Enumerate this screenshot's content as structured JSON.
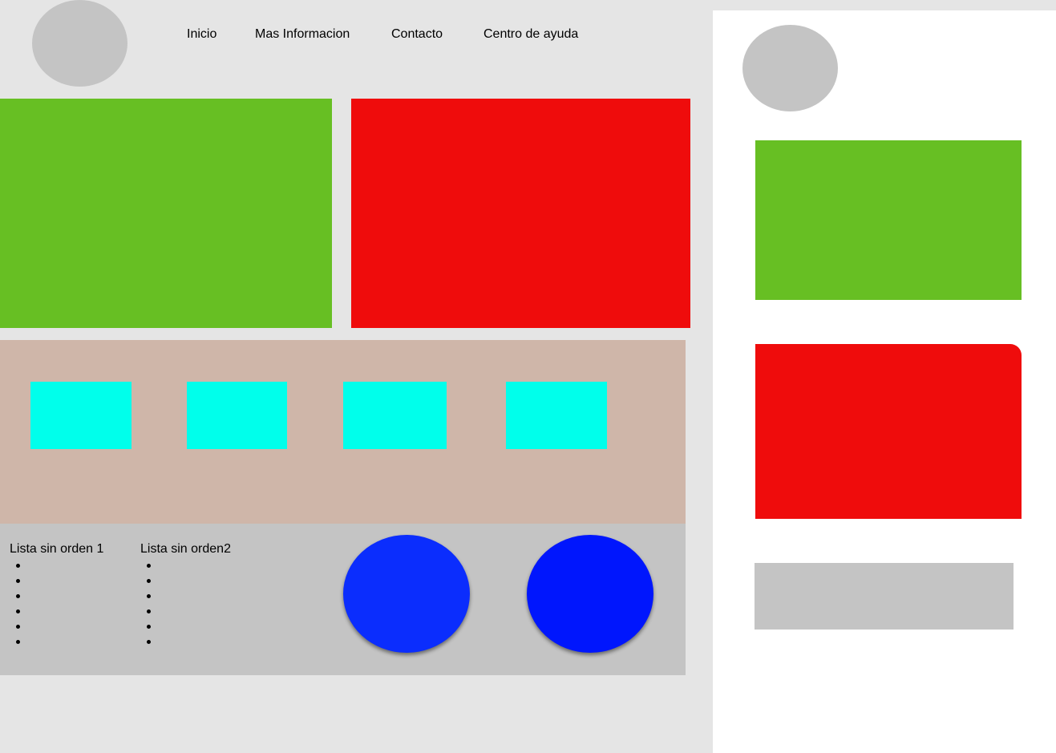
{
  "colors": {
    "background": "#e5e5e5",
    "mobile_background": "#ffffff",
    "placeholder_gray": "#c4c4c4",
    "green": "#67bf23",
    "red": "#ef0c0c",
    "tan": "#cfb6a9",
    "cyan": "#00ffeb",
    "blue_1": "#0b2dfd",
    "blue_2": "#0016fd"
  },
  "nav": {
    "items": [
      {
        "label": "Inicio"
      },
      {
        "label": "Mas Informacion"
      },
      {
        "label": "Contacto"
      },
      {
        "label": "Centro de ayuda"
      }
    ]
  },
  "footer": {
    "lists": [
      {
        "title": "Lista sin orden 1",
        "item_count": 6
      },
      {
        "title": "Lista sin orden2",
        "item_count": 6
      }
    ]
  }
}
